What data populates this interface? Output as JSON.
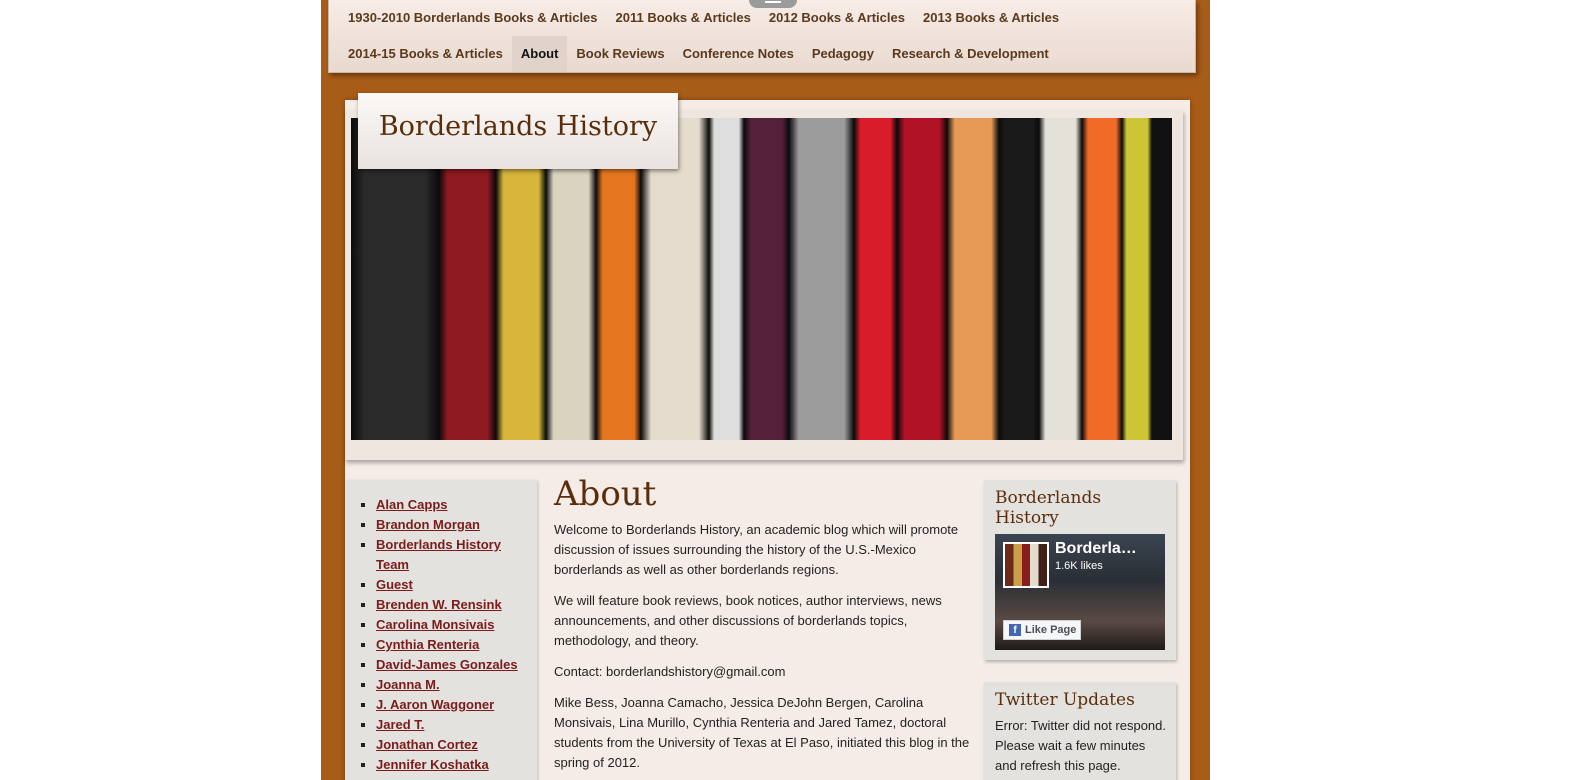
{
  "nav": {
    "row1": [
      "1930-2010 Borderlands Books & Articles",
      "2011 Books & Articles",
      "2012 Books & Articles",
      "2013 Books & Articles"
    ],
    "row2": [
      "2014-15 Books & Articles",
      "About",
      "Book Reviews",
      "Conference Notes",
      "Pedagogy",
      "Research & Development"
    ],
    "active": "About"
  },
  "site": {
    "title": "Borderlands History"
  },
  "banner": {
    "spines": [
      "#2a2a2a",
      "#8e1a22",
      "#d8b63a",
      "#d9d3bf",
      "#e57620",
      "#e6dccd",
      "#dedede",
      "#55203a",
      "#9c9c9c",
      "#d91c2a",
      "#b11225",
      "#e79a55",
      "#1a1a1a",
      "#e3e1d8",
      "#f06a28",
      "#ccc637"
    ]
  },
  "sidebar": {
    "authors": [
      "Alan Capps",
      "Brandon Morgan",
      "Borderlands History Team",
      "Guest",
      "Brenden W. Rensink",
      "Carolina Monsivais",
      "Cynthia Renteria",
      "David-James Gonzales",
      "Joanna M.",
      "J. Aaron Waggoner",
      "Jared T.",
      "Jonathan Cortez",
      "Jennifer Koshatka"
    ]
  },
  "main": {
    "heading": "About",
    "paragraphs": [
      "Welcome to Borderlands History, an academic blog which will promote discussion of issues surrounding the history of the U.S.-Mexico borderlands as well as other borderlands regions.",
      "We will feature book reviews, book notices, author interviews, news announcements, and other discussions of borderlands topics, methodology, and theory.",
      "Contact: borderlandshistory@gmail.com",
      "Mike Bess, Joanna Camacho, Jessica DeJohn Bergen, Carolina Monsivais, Lina Murillo, Cynthia Renteria and Jared Tamez, doctoral students from the University of Texas at El Paso, initiated this blog in the spring of 2012."
    ]
  },
  "widgets": {
    "facebook": {
      "title": "Borderlands History",
      "name": "Borderla…",
      "likes": "1.6K likes",
      "button": "Like Page"
    },
    "twitter": {
      "title": "Twitter Updates",
      "text": "Error: Twitter did not respond. Please wait a few minutes and refresh this page."
    }
  }
}
